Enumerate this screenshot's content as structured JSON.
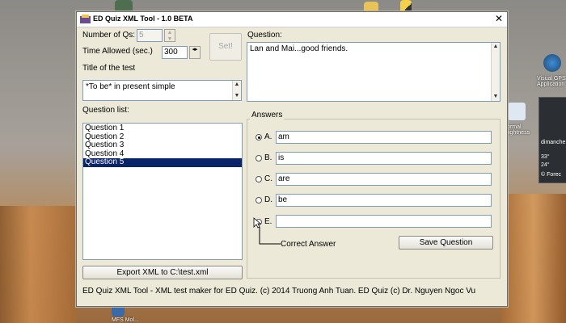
{
  "window": {
    "title": "ED Quiz XML Tool - 1.0 BETA",
    "close_glyph": "✕"
  },
  "settings": {
    "num_qs_label": "Number of Qs:",
    "num_qs_value": "5",
    "time_label": "Time Allowed (sec.)",
    "time_value": "300",
    "set_button": "Set!",
    "test_title_label": "Title of the test",
    "test_title_value": "*To be* in present simple"
  },
  "question": {
    "label": "Question:",
    "text": "Lan and Mai...good friends."
  },
  "question_list": {
    "label": "Question list:",
    "items": [
      "Question 1",
      "Question 2",
      "Question 3",
      "Question 4",
      "Question 5"
    ],
    "selected_index": 4
  },
  "export_button": "Export XML to C:\\test.xml",
  "answers": {
    "label": "Answers",
    "options": [
      {
        "letter": "A.",
        "value": "am",
        "selected": true
      },
      {
        "letter": "B.",
        "value": "is",
        "selected": false
      },
      {
        "letter": "C.",
        "value": "are",
        "selected": false
      },
      {
        "letter": "D.",
        "value": "be",
        "selected": false
      },
      {
        "letter": "E.",
        "value": "",
        "selected": false
      }
    ],
    "correct_answer_label": "Correct Answer",
    "save_button": "Save Question"
  },
  "footer": "ED Quiz XML Tool - XML test maker for ED Quiz. (c) 2014 Truong Anh Tuan. ED Quiz (c) Dr. Nguyen Ngoc Vu",
  "desktop": {
    "icon_labels": [
      "Visual GPS Application",
      "Normal Brightness",
      "MFS Mol..."
    ],
    "widget_lines": [
      "dimanche",
      "33°",
      "24°",
      "© Forec"
    ]
  },
  "colors": {
    "selection": "#0a246a",
    "window_bg": "#ece9d8"
  }
}
